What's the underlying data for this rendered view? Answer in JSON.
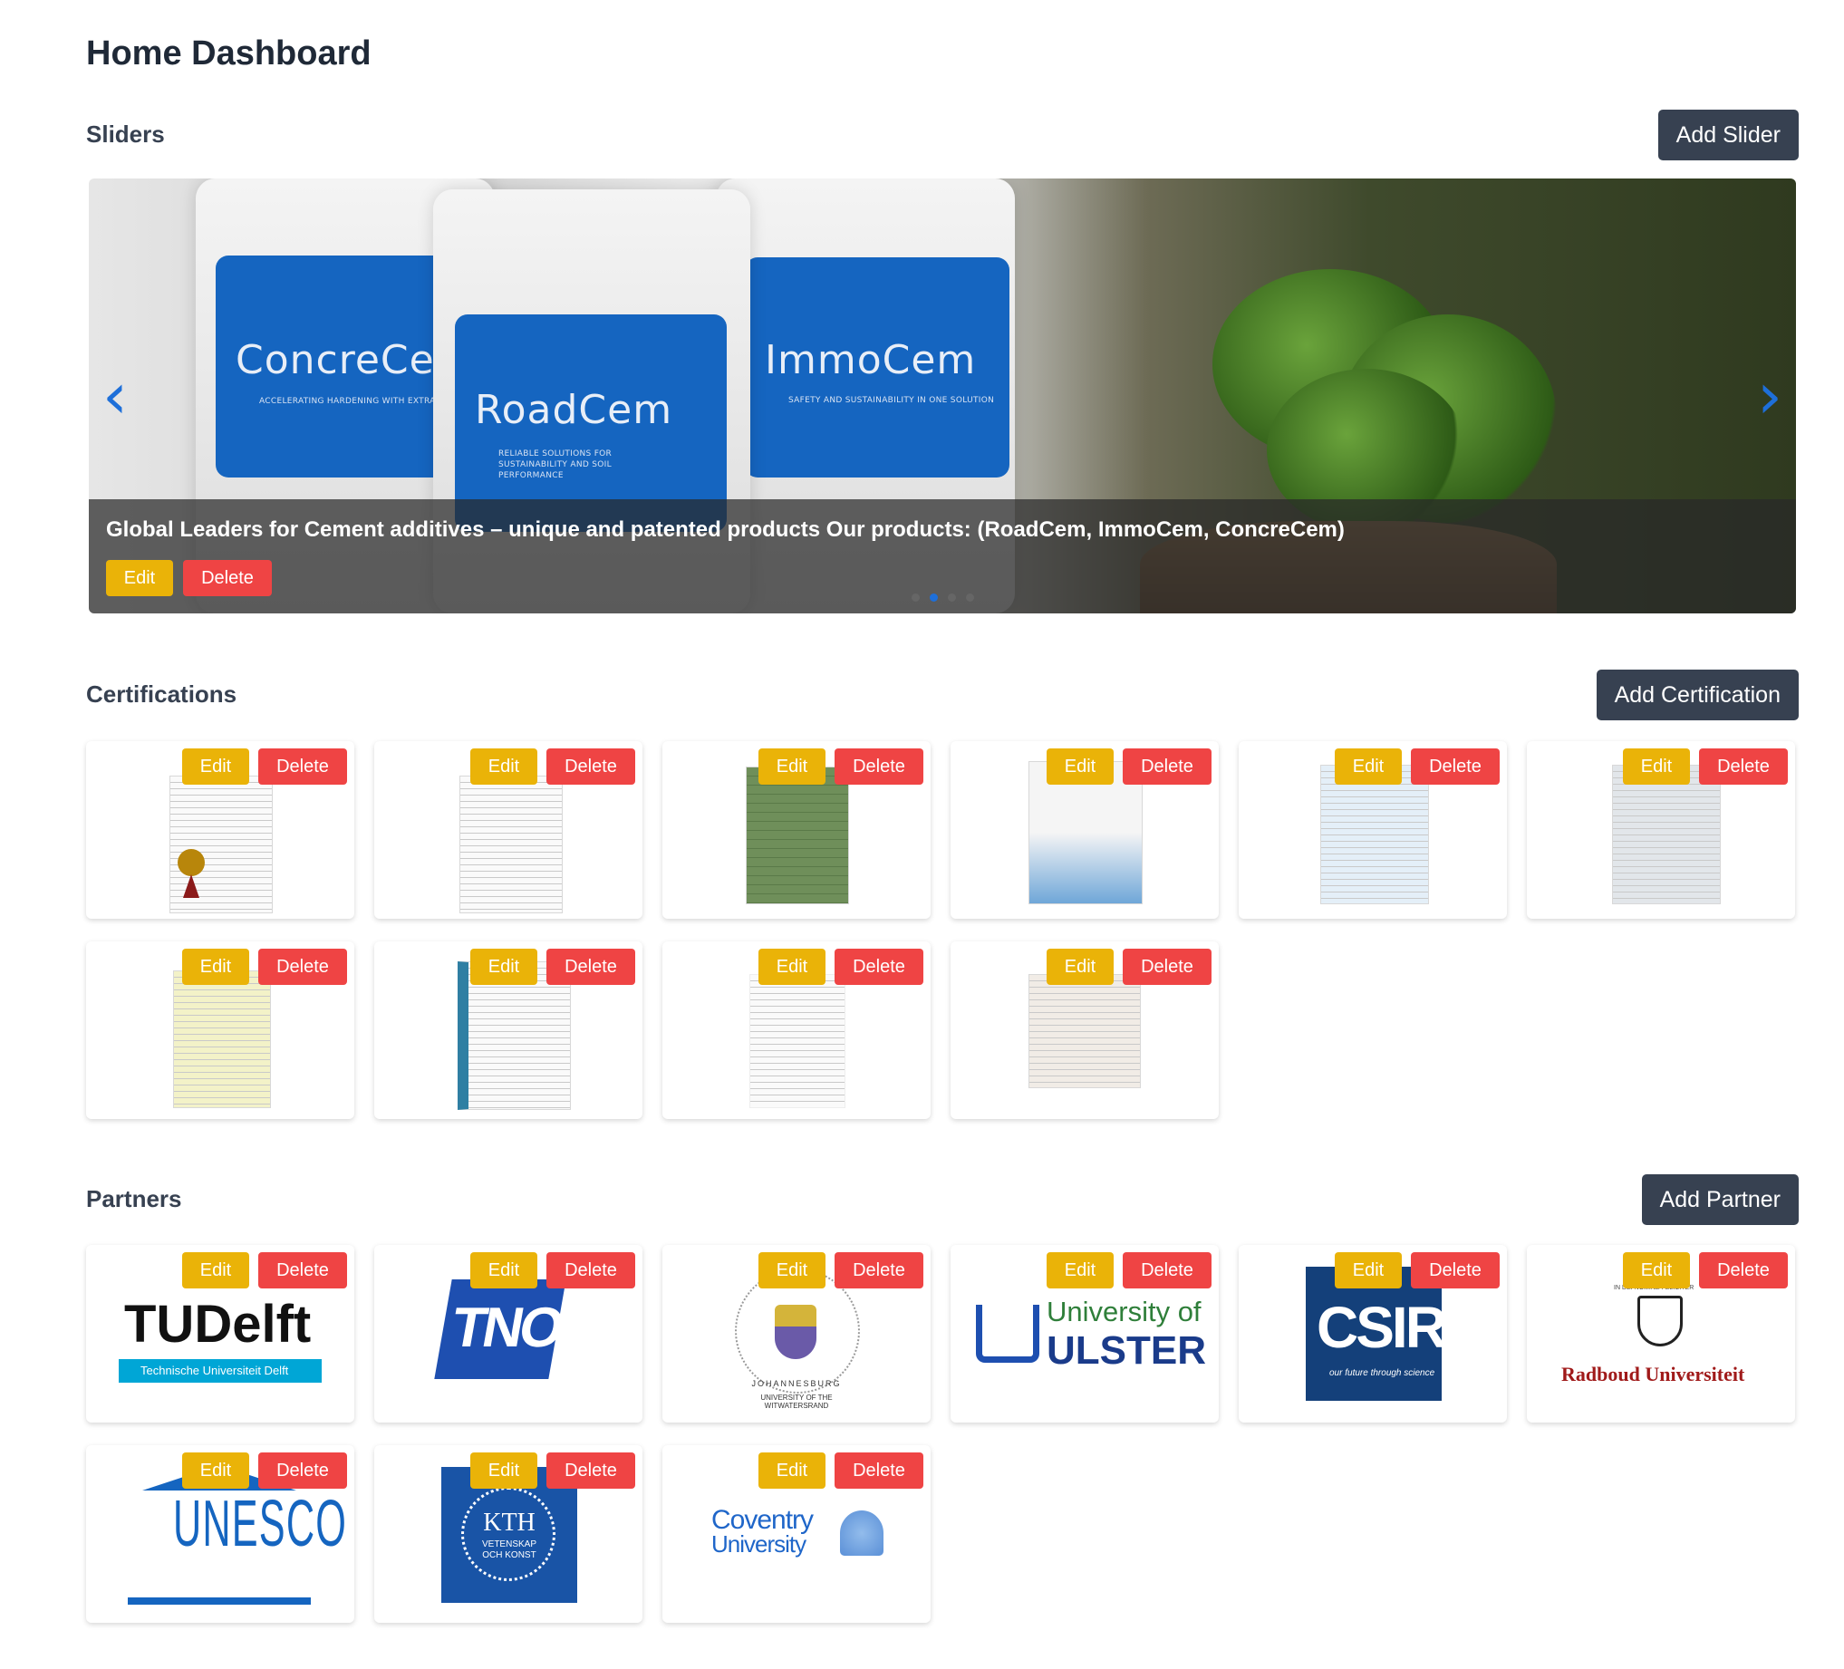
{
  "page": {
    "title": "Home Dashboard"
  },
  "sliders": {
    "title": "Sliders",
    "add_label": "Add Slider",
    "caption": "Global Leaders for Cement additives – unique and patented products Our products: (RoadCem, ImmoCem, ConcreCem)",
    "edit_label": "Edit",
    "delete_label": "Delete",
    "bags": [
      {
        "name": "ConcreCem",
        "sub": "ACCELERATING HARDENING WITH EXTRA PR"
      },
      {
        "name": "RoadCem",
        "sub": "RELIABLE SOLUTIONS FOR SUSTAINABILITY AND SOIL PERFORMANCE"
      },
      {
        "name": "ImmoCem",
        "sub": "SAFETY AND SUSTAINABILITY IN ONE SOLUTION"
      }
    ],
    "prev_icon": "chevron-left-icon",
    "next_icon": "chevron-right-icon",
    "dots": 4,
    "active_dot": 2
  },
  "certifications": {
    "title": "Certifications",
    "add_label": "Add Certification",
    "edit_label": "Edit",
    "delete_label": "Delete",
    "items": [
      {
        "id": 1
      },
      {
        "id": 2
      },
      {
        "id": 3
      },
      {
        "id": 4
      },
      {
        "id": 5
      },
      {
        "id": 6
      },
      {
        "id": 7
      },
      {
        "id": 8
      },
      {
        "id": 9
      },
      {
        "id": 10
      }
    ]
  },
  "partners": {
    "title": "Partners",
    "add_label": "Add Partner",
    "edit_label": "Edit",
    "delete_label": "Delete",
    "logos": {
      "tudelft": {
        "main": "TUDelft",
        "sub": "Technische Universiteit Delft"
      },
      "tno": {
        "main": "TNO"
      },
      "wits": {
        "top": "UNIVERSITY OF THE WITWATERSRAND",
        "bottom": "JOHANNESBURG"
      },
      "ulster": {
        "line1": "University of",
        "line2": "ULSTER"
      },
      "csir": {
        "main": "CSIR",
        "sub": "our future through science"
      },
      "radboud": {
        "main": "Radboud Universiteit",
        "motto": "IN DEI NOMINE FELICITER"
      },
      "unesco": {
        "main": "UNESCO"
      },
      "kth": {
        "main": "KTH",
        "sub1": "VETENSKAP",
        "sub2": "OCH KONST"
      },
      "coventry": {
        "line1": "Coventry",
        "line2": "University"
      }
    }
  },
  "colors": {
    "dark_button": "#374151",
    "edit": "#eab308",
    "delete": "#ef4444",
    "accent": "#1e6fd9"
  }
}
